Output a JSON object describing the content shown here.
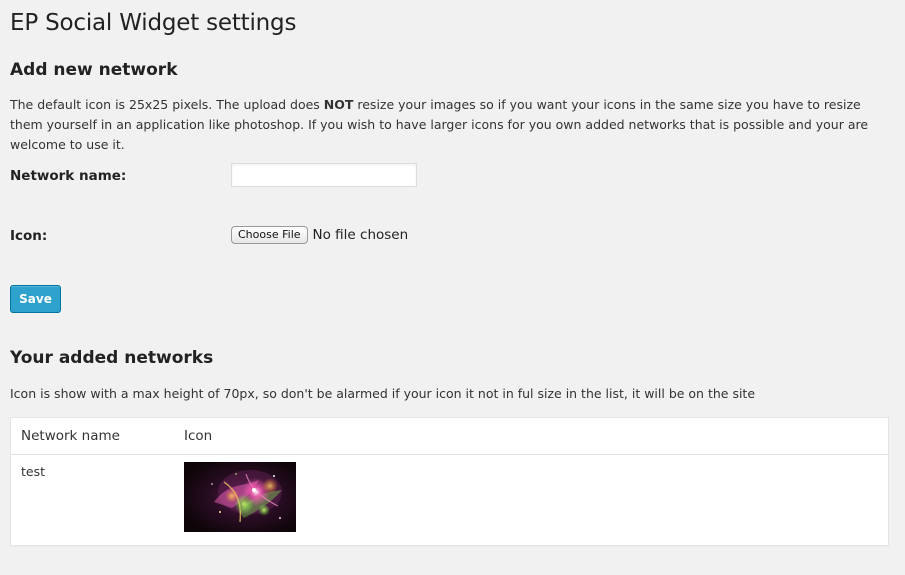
{
  "page": {
    "title": "EP Social Widget settings"
  },
  "add_section": {
    "heading": "Add new network",
    "description_before": "The default icon is 25x25 pixels. The upload does ",
    "description_bold": "NOT",
    "description_after": " resize your images so if you want your icons in the same size you have to resize them yourself in an application like photoshop. If you wish to have larger icons for you own added networks that is possible and your are welcome to use it.",
    "network_name_label": "Network name:",
    "network_name_value": "",
    "icon_label": "Icon:",
    "choose_file_label": "Choose File",
    "no_file_text": "No file chosen",
    "save_label": "Save"
  },
  "networks_section": {
    "heading": "Your added networks",
    "description": "Icon is show with a max height of 70px, so don't be alarmed if your icon it not in ful size in the list, it will be on the site",
    "columns": [
      "Network name",
      "Icon"
    ],
    "rows": [
      {
        "name": "test",
        "icon": "abstract-colorful-image"
      }
    ]
  },
  "colors": {
    "background": "#f1f1f1",
    "primary_button": "#2ea2cc",
    "primary_button_border": "#0074a2",
    "table_background": "#ffffff"
  }
}
